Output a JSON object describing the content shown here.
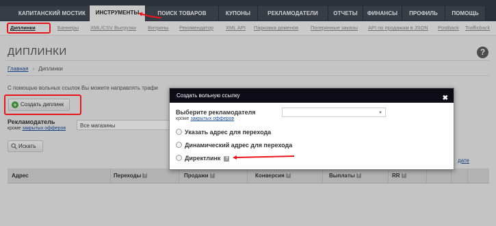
{
  "top_nav": {
    "tabs": [
      {
        "label": "Капитанский мостик",
        "active": false
      },
      {
        "label": "Инструменты",
        "active": true
      },
      {
        "label": "Поиск товаров",
        "active": false
      },
      {
        "label": "Купоны",
        "active": false
      },
      {
        "label": "Рекламодатели",
        "active": false
      },
      {
        "label": "Отчеты",
        "active": false
      },
      {
        "label": "Финансы",
        "active": false
      },
      {
        "label": "Профиль",
        "active": false
      },
      {
        "label": "Помощь",
        "active": false
      }
    ]
  },
  "sub_nav": {
    "items": [
      "Диплинки",
      "Баннеры",
      "XML/CSV Выгрузки",
      "Витрины",
      "Рекомендатор",
      "XML API",
      "Парковка доменов",
      "Потерянные заказы",
      "API по продажам в JSON",
      "Postback",
      "Trafficback"
    ],
    "active": "Диплинки"
  },
  "page": {
    "title": "ДИПЛИНКИ",
    "help": "?",
    "breadcrumb_home": "Главная",
    "breadcrumb_sep": "›",
    "breadcrumb_current": "Диплинки",
    "intro_text": "С помощью вольных ссылок Вы можете направлять трафи",
    "create_button": "Создать диплинк",
    "create_button_icon": "plus-icon"
  },
  "filter": {
    "label": "Рекламодатель",
    "sublabel_prefix": "кроме",
    "sublabel_link": "закрытых офферов",
    "select_value": "Все магазины",
    "search_button": "Искать",
    "search_icon": "magnifier-icon",
    "right_link_partial": "дате"
  },
  "table": {
    "columns": [
      "Адрес",
      "Переходы",
      "Продажи",
      "Конверсия",
      "Выплаты",
      "RR"
    ]
  },
  "modal": {
    "title": "Создать вольную ссылку",
    "close": "✖",
    "advertiser_label": "Выберите рекламодателя",
    "advertiser_sub_prefix": "кроме",
    "advertiser_sub_link": "закрытых офферов",
    "advertiser_select_value": "",
    "options": [
      "Указать адрес для перехода",
      "Динамический адрес для перехода",
      "Директлинк"
    ],
    "help_badge": "?"
  },
  "colors": {
    "nav_bg": "#343c47",
    "accent_red": "#e8141a",
    "modal_header": "#0d0c17",
    "link_blue": "#1a4d9e"
  }
}
